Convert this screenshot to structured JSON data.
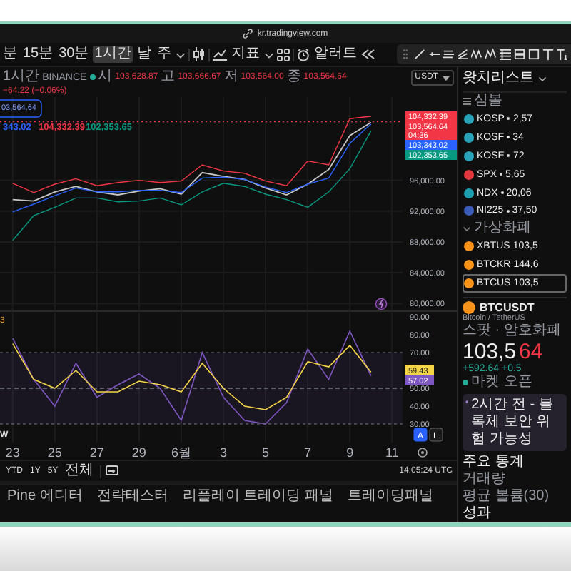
{
  "window": {
    "url": "kr.tradingview.com"
  },
  "toolbar": {
    "intervals": [
      {
        "label": "분",
        "selected": false
      },
      {
        "label": "15분",
        "selected": false
      },
      {
        "label": "30분",
        "selected": false
      },
      {
        "label": "1시간",
        "selected": true
      },
      {
        "label": "날",
        "selected": false
      },
      {
        "label": "주",
        "selected": false
      }
    ],
    "indicators_label": "지표",
    "alert_label": "알러트"
  },
  "symbol_bar": {
    "interval": "1시간",
    "exchange": "BINANCE",
    "ohlc": [
      {
        "label": "시",
        "value": "103,628.87"
      },
      {
        "label": "고",
        "value": "103,666.67"
      },
      {
        "label": "저",
        "value": "103,564.00"
      },
      {
        "label": "종",
        "value": "103,564.64"
      }
    ],
    "change": "−64.22 (−0.06%)",
    "currency": "USDT"
  },
  "price_chart": {
    "marker_label": "03,564.64",
    "legend": [
      {
        "text": "343.02",
        "color": "#2962ff"
      },
      {
        "text": "104,332.39",
        "color": "#f23645"
      },
      {
        "text": "102,353.65",
        "color": "#089981"
      }
    ],
    "price_labels": [
      {
        "text": "104,332.39",
        "color": "#f23645"
      },
      {
        "text": "103,564.64",
        "sub": "04:36",
        "color": "#f23645"
      },
      {
        "text": "103,343.02",
        "color": "#2962ff"
      },
      {
        "text": "102,353.65",
        "color": "#089981"
      }
    ],
    "chart_data": {
      "type": "line",
      "grid": true,
      "ylim": [
        79000,
        106800
      ],
      "ref_lines": [
        {
          "axis": "y",
          "value": 103600,
          "color": "#f23645"
        }
      ],
      "yticks": [
        {
          "value": 80000,
          "label": "80,000.00"
        },
        {
          "value": 84000,
          "label": "84,000.00"
        },
        {
          "value": 88000,
          "label": "88,000.00"
        },
        {
          "value": 92000,
          "label": "92,000.00"
        },
        {
          "value": 96000,
          "label": "96,000.00"
        }
      ],
      "series": [
        {
          "color": "#c8c8c8",
          "values": [
            93500,
            93300,
            94500,
            95200,
            94500,
            94100,
            94600,
            94900,
            94200,
            97000,
            96500,
            96100,
            95000,
            94100,
            95500,
            97400,
            101800,
            103500
          ]
        },
        {
          "color": "#f23645",
          "values": [
            95600,
            94400,
            95500,
            96200,
            95300,
            95700,
            96000,
            95700,
            95900,
            98000,
            97200,
            96900,
            95900,
            95300,
            98500,
            98000,
            104000,
            104300
          ]
        },
        {
          "color": "#2962ff",
          "values": [
            91900,
            92900,
            94000,
            95000,
            94500,
            94500,
            94700,
            94700,
            94400,
            96300,
            96400,
            96100,
            95100,
            94400,
            95500,
            96300,
            100800,
            103300
          ]
        },
        {
          "color": "#089981",
          "values": [
            88200,
            91400,
            92500,
            93700,
            93700,
            93200,
            93300,
            93700,
            92800,
            94500,
            95600,
            95200,
            94200,
            93500,
            92500,
            94500,
            97500,
            102400
          ]
        }
      ]
    }
  },
  "rsi_chart": {
    "period_label": "3",
    "pane_label": "W",
    "value_labels": [
      {
        "text": "59.43",
        "color": "#f5d547"
      },
      {
        "text": "57.02",
        "color": "#7e57c2"
      }
    ],
    "scale_buttons": [
      {
        "label": "A",
        "selected": true
      },
      {
        "label": "L",
        "selected": false
      }
    ],
    "chart_data": {
      "type": "line",
      "categories": [
        "23",
        null,
        "25",
        null,
        "27",
        null,
        "29",
        null,
        "6월",
        null,
        "3",
        null,
        "5",
        null,
        "7",
        null,
        "9",
        null,
        "11"
      ],
      "ylim": [
        19.6,
        93.2
      ],
      "grid": true,
      "bands": [
        {
          "axis": "y",
          "from": 30,
          "to": 70,
          "color": "#7e57c2"
        }
      ],
      "ref_lines": [
        {
          "axis": "y",
          "value": 50,
          "color": "#787b86"
        }
      ],
      "yticks": [
        {
          "value": 30,
          "label": "30.00"
        },
        {
          "value": 40,
          "label": "40.00"
        },
        {
          "value": 50,
          "label": "50.00"
        },
        {
          "value": 70,
          "label": "70.00"
        },
        {
          "value": 80,
          "label": "80.00"
        },
        {
          "value": 90,
          "label": "90.00"
        }
      ],
      "series": [
        {
          "color": "#7e57c2",
          "values": [
            78,
            55,
            40,
            64,
            45,
            52,
            58,
            50,
            32,
            70,
            45,
            32,
            30,
            42,
            72,
            55,
            82,
            57,
            null
          ]
        },
        {
          "color": "#f5d547",
          "values": [
            75,
            55,
            50,
            60,
            48,
            48,
            54,
            52,
            48,
            64,
            50,
            40,
            38,
            45,
            65,
            62,
            74,
            59,
            null
          ]
        }
      ]
    }
  },
  "range_bar": {
    "ranges": [
      "YTD",
      "1Y",
      "5Y",
      "전체"
    ],
    "time": "14:05:24 UTC"
  },
  "bottom_tabs": [
    "Pine 에디터",
    "전략테스터",
    "리플레이 트레이딩 패널",
    "트레이딩패널"
  ],
  "watchlist": {
    "title": "왓치리스트",
    "column": "심볼",
    "items": [
      {
        "symbol": "KOSP",
        "value": "2,57",
        "color": "#2aa3b8",
        "selected": false
      },
      {
        "symbol": "KOSF",
        "value": "34",
        "color": "#2aa3b8",
        "selected": false
      },
      {
        "symbol": "KOSE",
        "value": "72",
        "color": "#2aa3b8",
        "selected": false
      },
      {
        "symbol": "SPX",
        "value": "5,65",
        "color": "#e0393e",
        "selected": false
      },
      {
        "symbol": "NDX",
        "value": "20,06",
        "color": "#1e9fb0",
        "selected": false
      },
      {
        "symbol": "NI225",
        "value": "37,50",
        "color": "#3a5bb8",
        "selected": false
      }
    ],
    "section": {
      "title": "가상화폐",
      "expanded": true,
      "items": [
        {
          "symbol": "XBTUS",
          "value": "103,5",
          "color": "#f7931a",
          "selected": false
        },
        {
          "symbol": "BTCKR",
          "value": "144,6",
          "color": "#f7931a",
          "selected": false
        },
        {
          "symbol": "BTCUS",
          "value": "103,5",
          "color": "#f7931a",
          "selected": true
        }
      ]
    }
  },
  "details": {
    "symbol": "BTCUSDT",
    "name": "Bitcoin / TetherUS",
    "type": "스팟 · 암호화폐",
    "price": "103,5",
    "price_tail": "64",
    "change": "+592.64",
    "change_pct": "+0.5",
    "status": "마켓 오픈",
    "notice": "2시간 전 - 블록체 보안 위험 가능성",
    "stats_title": "주요 통계",
    "stats": [
      "거래량",
      "평균 볼륨(30)"
    ],
    "performance_title": "성과"
  }
}
